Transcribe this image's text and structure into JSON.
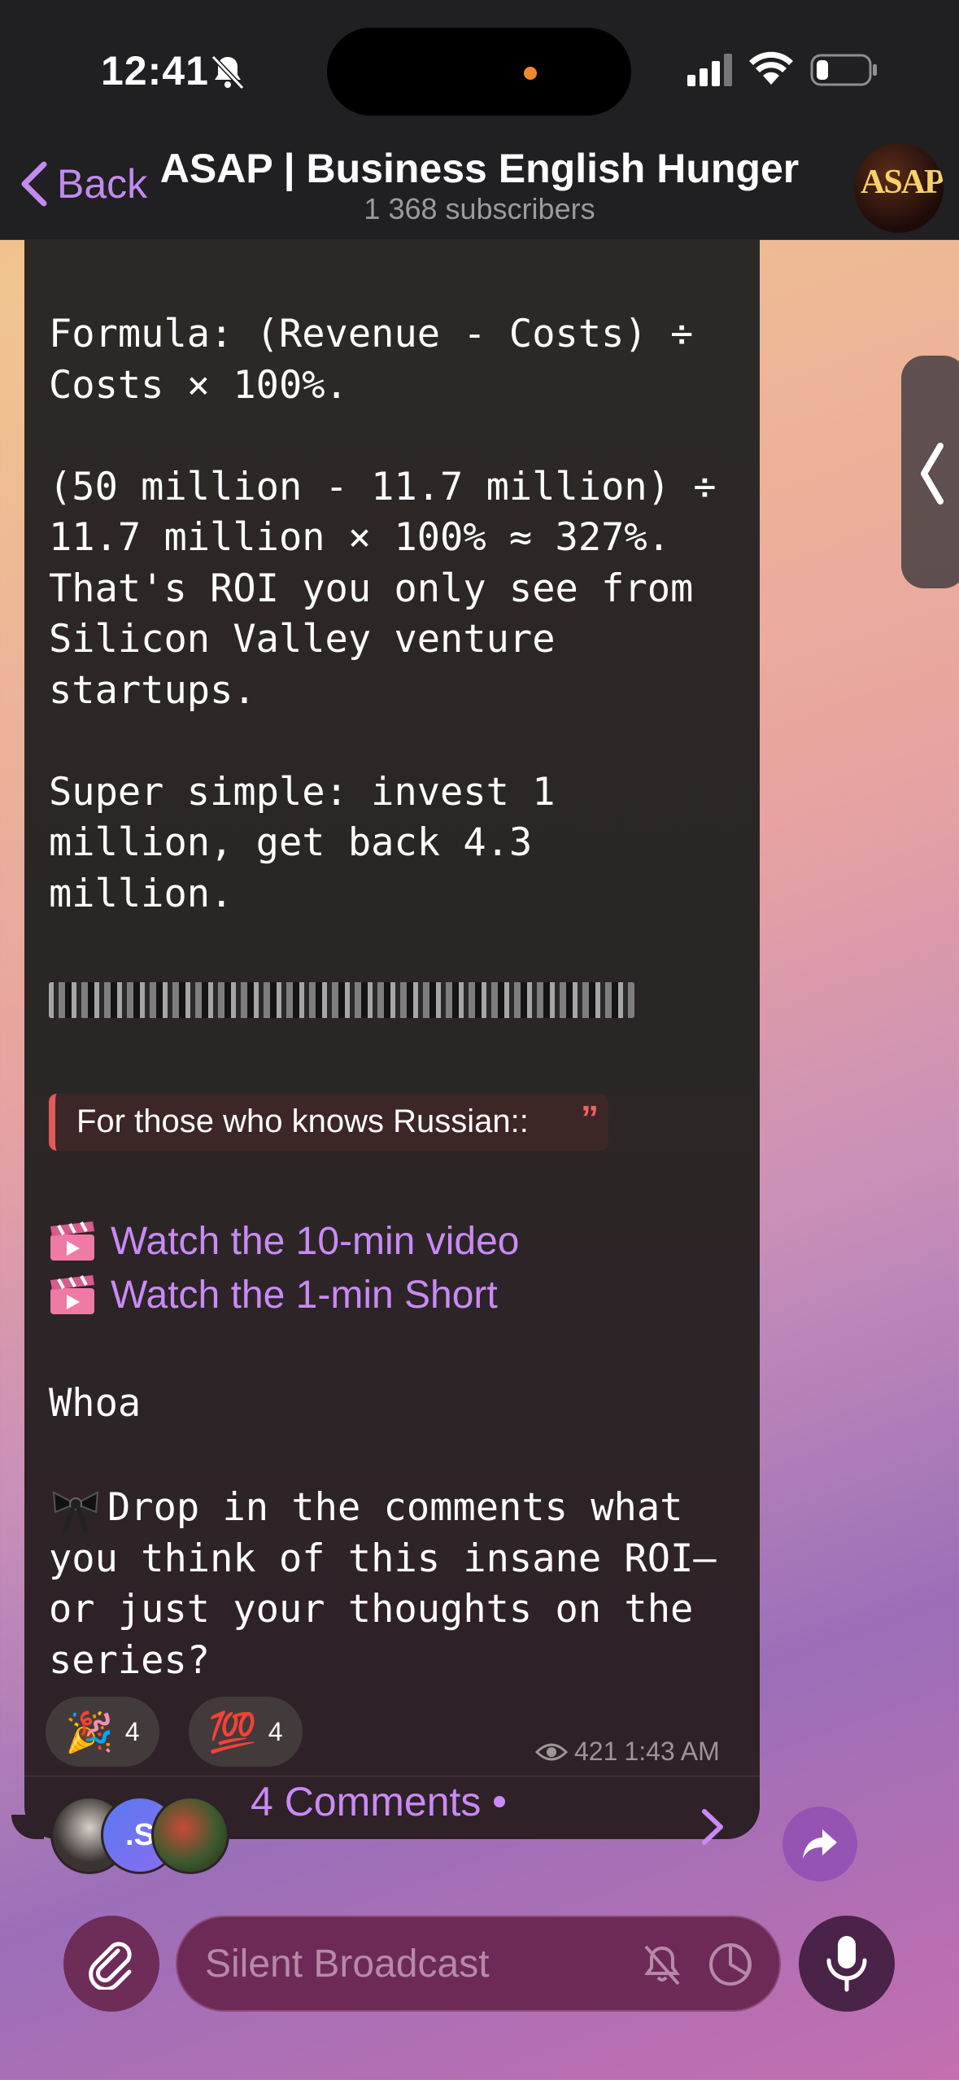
{
  "status_bar": {
    "time": "12:41"
  },
  "nav": {
    "back_label": "Back",
    "title": "ASAP | Business English Hunger",
    "subtitle": "1 368 subscribers",
    "avatar_text": "ASAP"
  },
  "message": {
    "text_top": "Formula: (Revenue - Costs) ÷\nCosts × 100%.\n\n(50 million - 11.7 million) ÷\n11.7 million × 100% ≈ 327%.\nThat's ROI you only see from\nSilicon Valley venture\nstartups.\n\nSuper simple: invest 1\nmillion, get back 4.3\nmillion.",
    "quote_text": "For those who knows Russian::",
    "links": [
      {
        "label": "Watch the 10-min video"
      },
      {
        "label": "Watch the 1-min Short"
      }
    ],
    "whoa": "Whoa",
    "closing": "Drop in the comments what\nyou think of this insane ROI—\nor just your thoughts on the\nseries?",
    "reactions": [
      {
        "emoji": "🎉",
        "count": "4"
      },
      {
        "emoji": "💯",
        "count": "4"
      }
    ],
    "views": "421",
    "sent_time": "1:43 AM",
    "comments_label": "4 Comments",
    "commenter_initial": ".S"
  },
  "composer": {
    "placeholder": "Silent Broadcast"
  },
  "colors": {
    "accent": "#c98af5",
    "bubble": "#2b2626",
    "bar": "#201f21",
    "quote_bar": "#e05b5b"
  }
}
